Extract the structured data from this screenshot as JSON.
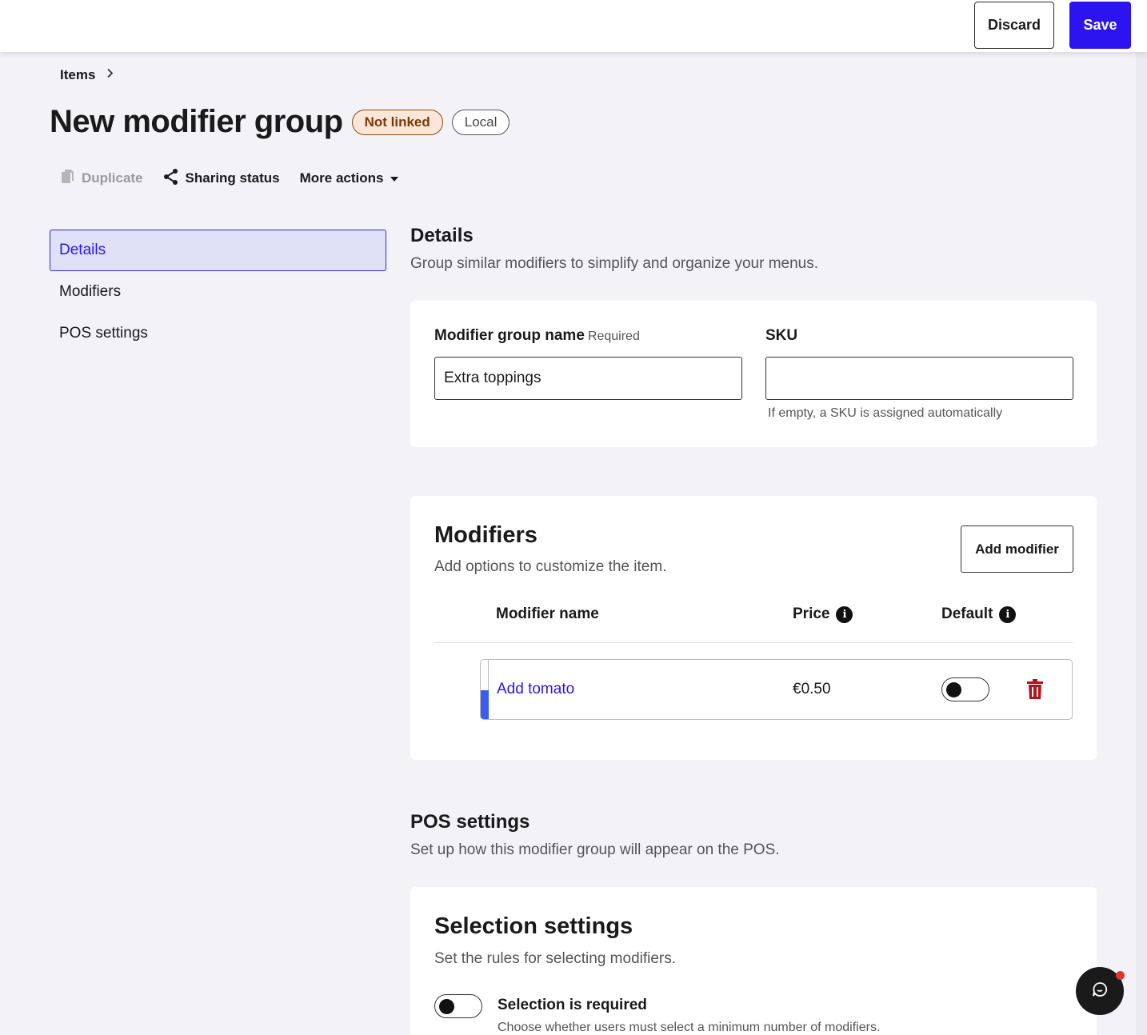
{
  "topbar": {
    "discard_label": "Discard",
    "save_label": "Save"
  },
  "breadcrumb": {
    "items_label": "Items"
  },
  "page": {
    "title": "New modifier group",
    "badges": {
      "not_linked": "Not linked",
      "local": "Local"
    }
  },
  "actions": {
    "duplicate": "Duplicate",
    "sharing_status": "Sharing status",
    "more_actions": "More actions"
  },
  "sidebar": {
    "items": [
      {
        "label": "Details",
        "active": true
      },
      {
        "label": "Modifiers",
        "active": false
      },
      {
        "label": "POS settings",
        "active": false
      }
    ]
  },
  "details": {
    "title": "Details",
    "description": "Group similar modifiers to simplify and organize your menus.",
    "name_label": "Modifier group name",
    "name_required": "Required",
    "name_value": "Extra toppings",
    "sku_label": "SKU",
    "sku_value": "",
    "sku_hint": "If empty, a SKU is assigned automatically"
  },
  "modifiers": {
    "title": "Modifiers",
    "description": "Add options to customize the item.",
    "add_label": "Add modifier",
    "columns": {
      "name": "Modifier name",
      "price": "Price",
      "default": "Default"
    },
    "rows": [
      {
        "name": "Add tomato",
        "price": "€0.50",
        "default": false
      }
    ]
  },
  "pos_settings": {
    "title": "POS settings",
    "description": "Set up how this modifier group will appear on the POS."
  },
  "selection_settings": {
    "title": "Selection settings",
    "description": "Set the rules for selecting modifiers.",
    "required_label": "Selection is required",
    "required_desc": "Choose whether users must select a minimum number of modifiers.",
    "required_on": false
  },
  "colors": {
    "primary": "#2b14f0",
    "background": "#f2f2f7",
    "not_linked_bg": "#fbe6d8",
    "delete": "#b3141a"
  },
  "icons": {
    "breadcrumb_separator": "chevron-right-icon",
    "duplicate": "copy-icon",
    "sharing": "share-icon",
    "more": "caret-down-icon",
    "info": "info-icon",
    "delete": "trash-icon",
    "chat": "chat-icon"
  }
}
